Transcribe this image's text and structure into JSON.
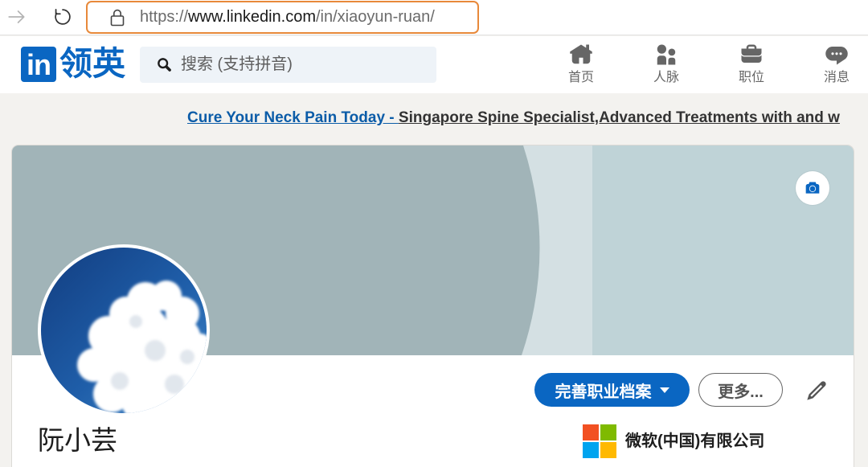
{
  "theme": {
    "brand": "#0a66c2",
    "highlight": "#e8893a",
    "page_bg": "#f3f2ef",
    "cover_dark": "#a1b4b8",
    "cover_band": "#d4e0e3",
    "cover_light": "#bfd3d7",
    "ad_link": "#0b5ca8"
  },
  "browser": {
    "url_scheme": "https://",
    "url_host": "www.linkedin.com",
    "url_path": "/in/xiaoyun-ruan/",
    "icons": {
      "forward": "arrow-right-icon",
      "reload": "reload-icon",
      "secure": "lock-icon"
    }
  },
  "header": {
    "logo_mark": "in",
    "logo_text": "领英",
    "search_placeholder": "搜索 (支持拼音)",
    "search_icon": "search-icon",
    "nav": [
      {
        "label": "首页",
        "icon": "home-icon"
      },
      {
        "label": "人脉",
        "icon": "people-icon"
      },
      {
        "label": "职位",
        "icon": "briefcase-icon"
      },
      {
        "label": "消息",
        "icon": "message-icon"
      }
    ]
  },
  "ad": {
    "headline": "Cure Your Neck Pain Today - ",
    "body": "Singapore Spine Specialist,Advanced Treatments with and w"
  },
  "profile": {
    "name": "阮小芸",
    "primary_button": "完善职业档案",
    "more_button": "更多...",
    "current_company": "微软(中国)有限公司",
    "icons": {
      "cover_edit": "camera-icon",
      "intro_edit": "pencil-icon",
      "company_logo": "microsoft-logo"
    }
  }
}
